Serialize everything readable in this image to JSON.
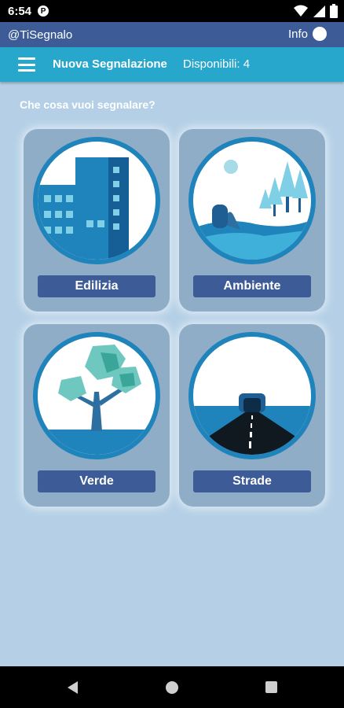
{
  "status": {
    "time": "6:54",
    "app_badge": "P",
    "icons": [
      "wifi-icon",
      "signal-icon",
      "battery-icon"
    ]
  },
  "appbar": {
    "title": "@TiSegnalo",
    "info_label": "Info"
  },
  "toolbar": {
    "title": "Nuova Segnalazione",
    "available": "Disponibili: 4"
  },
  "main": {
    "question": "Che cosa vuoi segnalare?",
    "cards": [
      {
        "label": "Edilizia",
        "icon": "building-icon"
      },
      {
        "label": "Ambiente",
        "icon": "landscape-icon"
      },
      {
        "label": "Verde",
        "icon": "tree-icon"
      },
      {
        "label": "Strade",
        "icon": "road-tunnel-icon"
      }
    ]
  },
  "colors": {
    "background": "#b5d0e6",
    "appbar": "#3d5c97",
    "toolbar": "#28a7cc",
    "card": "#90adc8",
    "circle_border": "#1e84bb"
  }
}
